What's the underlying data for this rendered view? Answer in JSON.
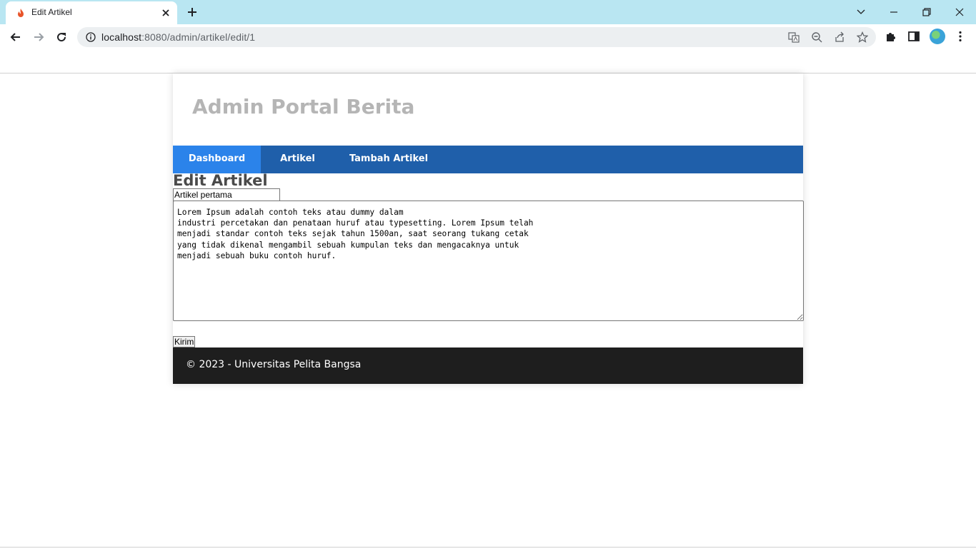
{
  "browser": {
    "tab_title": "Edit Artikel",
    "url_host": "localhost",
    "url_rest": ":8080/admin/artikel/edit/1",
    "icons": [
      "fire-favicon-icon",
      "close-icon",
      "plus-icon",
      "chevron-down-icon",
      "minimize-icon",
      "restore-icon",
      "window-close-icon",
      "back-icon",
      "forward-icon",
      "reload-icon",
      "info-icon",
      "translate-icon",
      "zoom-out-icon",
      "share-icon",
      "star-icon",
      "puzzle-icon",
      "sidepanel-icon",
      "avatar",
      "kebab-menu-icon"
    ]
  },
  "site": {
    "title": "Admin Portal Berita",
    "nav": [
      {
        "label": "Dashboard",
        "active": true
      },
      {
        "label": "Artikel",
        "active": false
      },
      {
        "label": "Tambah Artikel",
        "active": false
      }
    ],
    "nav_active_color": "#2b83ea",
    "nav_color": "#1f5faa"
  },
  "form": {
    "heading": "Edit Artikel",
    "title_value": "Artikel pertama",
    "content_value": "Lorem Ipsum adalah contoh teks atau dummy dalam\nindustri percetakan dan penataan huruf atau typesetting. Lorem Ipsum telah\nmenjadi standar contoh teks sejak tahun 1500an, saat seorang tukang cetak\nyang tidak dikenal mengambil sebuah kumpulan teks dan mengacaknya untuk\nmenjadi sebuah buku contoh huruf.",
    "submit_label": "Kirim"
  },
  "footer": {
    "text": "© 2023 - Universitas Pelita Bangsa"
  }
}
